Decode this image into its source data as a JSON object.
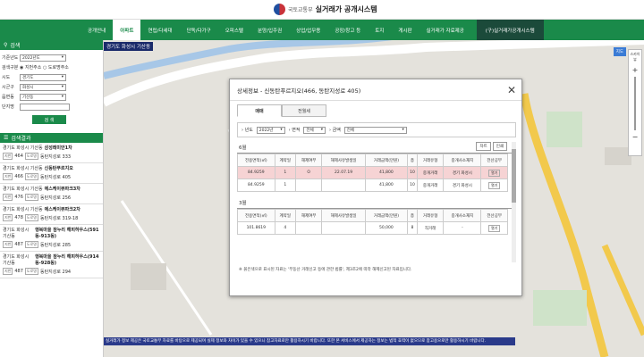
{
  "header": {
    "ministry": "국토교통부",
    "site_title": "실거래가 공개시스템"
  },
  "nav": [
    "공개안내",
    "아파트",
    "연립/다세대",
    "단독/다가구",
    "오피스텔",
    "분양/입주권",
    "상업/업무용",
    "공장/창고 등",
    "토지",
    "게시판",
    "실거래가 자료제공",
    "(구)실거래가공개시스템"
  ],
  "nav_active": 1,
  "location_label": "경기도 화성시 기산동",
  "sidebar": {
    "search_header": "검색",
    "filters": [
      {
        "label": "기준년도",
        "value": "2022년도"
      },
      {
        "label": "시도",
        "value": "경기도"
      },
      {
        "label": "시군구",
        "value": "화성시"
      },
      {
        "label": "읍면동",
        "value": "기산동"
      }
    ],
    "radio": {
      "label": "검색구분",
      "options": [
        "지번주소",
        "도로명주소"
      ]
    },
    "name_label": "단지명",
    "search_button": "검 색",
    "results_header": "검색결과",
    "results": [
      {
        "addr": "경기도 화성시 기산동",
        "name": "삼성래미안1차",
        "jibun": "464",
        "road": "동탄지성로 333"
      },
      {
        "addr": "경기도 화성시 기산동",
        "name": "신동탄푸르지오",
        "jibun": "466",
        "road": "동탄지성로 405"
      },
      {
        "addr": "경기도 화성시 기산동",
        "name": "에스케이뷰파크3차",
        "jibun": "476",
        "road": "동탄지성로 256"
      },
      {
        "addr": "경기도 화성시 기산동",
        "name": "에스케이뷰파크2차",
        "jibun": "478",
        "road": "동탄지성로 319-18"
      },
      {
        "addr": "경기도 화성시 기산동",
        "name": "행복마을 참누리 해피하우스(591동-913동)",
        "jibun": "487",
        "road": "동탄지성로 285"
      },
      {
        "addr": "경기도 화성시 기산동",
        "name": "행복마을 참누리 해피하우스(914동-928동)",
        "jibun": "487",
        "road": "동탄지성로 294"
      }
    ]
  },
  "map": {
    "layer_button": "지도",
    "skyview_button": "스카이뷰",
    "notice": "실거래가 정보 제공은 국토교통부 자료를 바탕으로 제공되며 실제 정보와 차이가 있을 수 있으니 참고자료로만 활용하시기 바랍니다. 또한 본 서비스에서 제공하는 정보는 법적 효력이 없으므로 참고용으로만 활용하시기 바랍니다."
  },
  "modal": {
    "title": "상세정보 - 신동탄푸르지오(466, 동탄지성로 405)",
    "tabs": [
      "매매",
      "전월세"
    ],
    "filters": [
      {
        "label": "년도",
        "value": "2022년"
      },
      {
        "label": "면적",
        "value": "전체"
      },
      {
        "label": "금액",
        "value": "전체"
      }
    ],
    "print_button": "차트",
    "print2_button": "인쇄",
    "columns": [
      "전용면적(㎡)",
      "계약일",
      "해제여부",
      "해제사유발생일",
      "거래금액(만원)",
      "층",
      "거래유형",
      "중개사소재지",
      "전산공부"
    ],
    "sections": [
      {
        "month": "6월",
        "rows": [
          {
            "area": "84.9259",
            "day": "1",
            "cancel": "O",
            "cancel_date": "22.07.19",
            "price": "41,800",
            "floor": "10",
            "type": "중개거래",
            "agent": "경기 화성시",
            "doc": "열기",
            "highlight": true
          },
          {
            "area": "84.9259",
            "day": "1",
            "cancel": "",
            "cancel_date": "",
            "price": "41,800",
            "floor": "10",
            "type": "중개거래",
            "agent": "경기 화성시",
            "doc": "열기",
            "highlight": false
          }
        ]
      },
      {
        "month": "3월",
        "rows": [
          {
            "area": "101.8619",
            "day": "4",
            "cancel": "",
            "cancel_date": "",
            "price": "50,000",
            "floor": "8",
            "type": "직거래",
            "agent": "-",
            "doc": "열기",
            "highlight": false
          }
        ]
      }
    ],
    "footnote": "※ 붉은색으로 표시된 자료는 '부동산 거래신고 등에 관한 법률', 제3조2에 따라 해제신고된 자료입니다."
  }
}
